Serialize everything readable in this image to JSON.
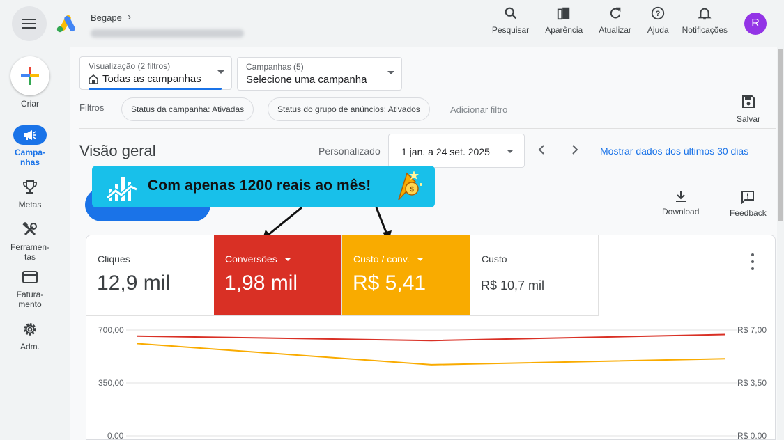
{
  "header": {
    "account_name": "Begape",
    "account_id_blurred": true,
    "actions": [
      {
        "label": "Pesquisar",
        "icon": "search-icon"
      },
      {
        "label": "Aparência",
        "icon": "appearance-icon"
      },
      {
        "label": "Atualizar",
        "icon": "refresh-icon"
      },
      {
        "label": "Ajuda",
        "icon": "help-icon"
      },
      {
        "label": "Notificações",
        "icon": "bell-icon"
      }
    ],
    "avatar_letter": "R"
  },
  "sidebar": {
    "create_label": "Criar",
    "items": [
      {
        "label": "Campa-\nnhas",
        "icon": "megaphone-icon",
        "active": true
      },
      {
        "label": "Metas",
        "icon": "trophy-icon",
        "active": false
      },
      {
        "label": "Ferramen-\ntas",
        "icon": "tools-icon",
        "active": false
      },
      {
        "label": "Fatura-\nmento",
        "icon": "credit-card-icon",
        "active": false
      },
      {
        "label": "Adm.",
        "icon": "gear-icon",
        "active": false
      }
    ]
  },
  "view_selector": {
    "small": "Visualização (2 filtros)",
    "value": "Todas as campanhas"
  },
  "campaign_selector": {
    "small": "Campanhas (5)",
    "value": "Selecione uma campanha"
  },
  "filters": {
    "label": "Filtros",
    "chips": [
      "Status da campanha: Ativadas",
      "Status do grupo de anúncios: Ativados"
    ],
    "add": "Adicionar filtro",
    "save": "Salvar"
  },
  "overview": {
    "title": "Visão geral",
    "custom_label": "Personalizado",
    "date_range": "1 jan. a 24 set. 2025",
    "last30": "Mostrar dados dos últimos 30 dias"
  },
  "banner": {
    "text": "Com apenas 1200 reais ao mês!"
  },
  "tools": {
    "download": "Download",
    "feedback": "Feedback"
  },
  "metrics": [
    {
      "label": "Cliques",
      "value": "12,9 mil",
      "bg": "#ffffff",
      "fg": "#3c4043",
      "dropdown": false
    },
    {
      "label": "Conversões",
      "value": "1,98 mil",
      "bg": "#d93025",
      "fg": "#ffffff",
      "dropdown": true
    },
    {
      "label": "Custo / conv.",
      "value": "R$ 5,41",
      "bg": "#f9ab00",
      "fg": "#ffffff",
      "dropdown": true
    },
    {
      "label": "Custo",
      "value": "R$ 10,7 mil",
      "bg": "#ffffff",
      "fg": "#3c4043",
      "dropdown": false
    }
  ],
  "chart_data": {
    "type": "line",
    "x": [
      0,
      1,
      2
    ],
    "left_axis": {
      "ticks": [
        "700,00",
        "350,00",
        "0,00"
      ],
      "range": [
        0,
        700
      ]
    },
    "right_axis": {
      "ticks": [
        "R$ 7,00",
        "R$ 3,50",
        "R$ 0,00"
      ],
      "range": [
        0,
        7
      ]
    },
    "series": [
      {
        "name": "Conversões",
        "axis": "left",
        "color": "#d93025",
        "values": [
          660,
          630,
          670
        ]
      },
      {
        "name": "Custo / conv.",
        "axis": "right",
        "color": "#f9ab00",
        "values": [
          6.1,
          4.7,
          5.1
        ]
      }
    ],
    "grid": true
  }
}
